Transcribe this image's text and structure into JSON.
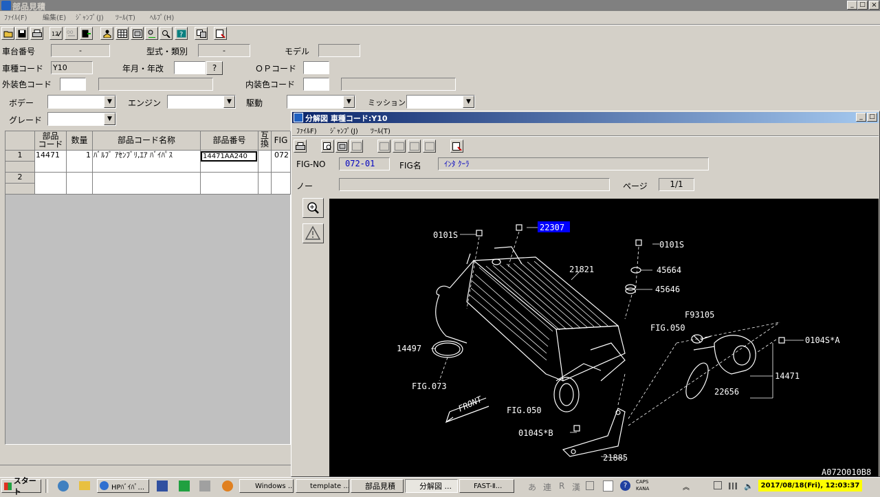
{
  "main_window": {
    "title": "部品見積",
    "menu": [
      "ﾌｧｲﾙ(F)",
      "編集(E)",
      "ｼﾞｬﾝﾌﾟ(J)",
      "ﾂｰﾙ(T)",
      "ﾍﾙﾌﾟ(H)"
    ],
    "form": {
      "vehicle_no_label": "車台番号",
      "vehicle_no_value": "-",
      "model_class_label": "型式・類別",
      "model_class_value": "-",
      "model_label": "モデル",
      "model_value": "",
      "type_code_label": "車種コード",
      "type_code_value": "Y10",
      "year_label": "年月・年改",
      "year_value": "",
      "year_help": "?",
      "op_code_label": "ＯＰコード",
      "op_code_value": "",
      "ext_color_label": "外装色コード",
      "ext_color_value": "",
      "int_color_label": "内装色コード",
      "int_color_value": "",
      "body_label": "ボデー",
      "engine_label": "エンジン",
      "drive_label": "駆動",
      "mission_label": "ミッション",
      "grade_label": "グレード"
    },
    "grid": {
      "headers": {
        "part_code": "部品\nコード",
        "qty": "数量",
        "name": "部品コード名称",
        "part_no": "部品番号",
        "interchange": "互\n換",
        "fig": "FIG"
      },
      "rows": [
        {
          "num": "1",
          "part_code": "14471",
          "qty": "1",
          "name": "ﾊﾞﾙﾌﾞ ｱｾﾝﾌﾞﾘ,ｴｱ ﾊﾞｲﾊﾟｽ",
          "part_no": "14471AA240",
          "interchange": "",
          "fig": "072"
        },
        {
          "num": "2",
          "part_code": "",
          "qty": "",
          "name": "",
          "part_no": "",
          "interchange": "",
          "fig": ""
        }
      ]
    }
  },
  "sub_window": {
    "title": "分解図 車種コード:Y10",
    "menu": [
      "ﾌｧｲﾙF)",
      "ｼﾞｬﾝﾌﾟ(J)",
      "ﾂｰﾙ(T)"
    ],
    "fig_no_label": "FIG-NO",
    "fig_no_value": "072-01",
    "fig_name_label": "FIG名",
    "fig_name_value": "ｲﾝﾀ ｸｰﾗ",
    "note_label": "ノー",
    "note_value": "",
    "page_label": "ページ",
    "page_value": "1/1",
    "diagram": {
      "highlighted_part": "22307",
      "labels": [
        "0101S",
        "22307",
        "0101S",
        "45664",
        "21821",
        "45646",
        "F93105",
        "FIG.050",
        "0104S*A",
        "14497",
        "14471",
        "FIG.073",
        "22656",
        "FIG.050",
        "0104S*B",
        "21885"
      ],
      "front_label": "FRONT",
      "code": "A072O010B8"
    }
  },
  "taskbar": {
    "start": "スタート",
    "buttons": [
      "HPﾊﾞｲﾊﾟ...",
      "Windows ...",
      "template ...",
      "部品見積",
      "分解図 ...",
      "FAST-Ⅱ..."
    ],
    "ime": [
      "あ",
      "連",
      "R",
      "漢"
    ],
    "caps": "CAPS",
    "kana": "KANA",
    "clock": "2017/08/18(Fri), 12:03:37"
  },
  "colors": {
    "title_gradient_start": "#0a246a",
    "title_gradient_end": "#a6caf0",
    "inactive_title": "#808080",
    "diagram_bg": "#000000",
    "fig_value_color": "#0000c0",
    "highlight_bg": "#0000ff",
    "clock_bg": "#ffff00"
  }
}
